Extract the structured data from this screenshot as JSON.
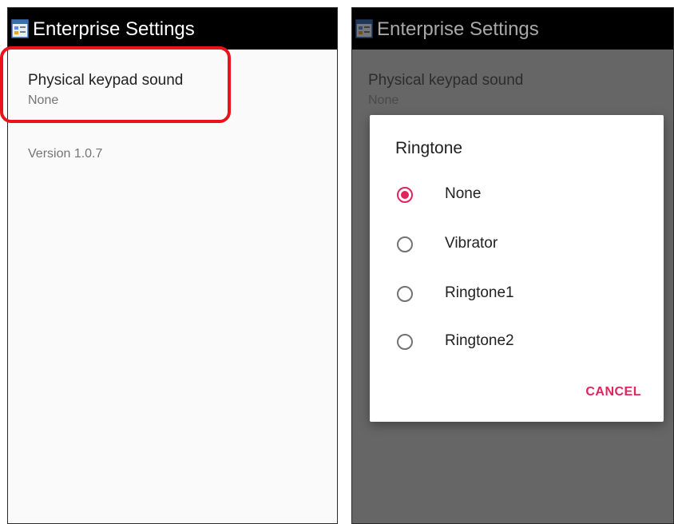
{
  "left_screen": {
    "app_title": "Enterprise Settings",
    "preference": {
      "title": "Physical keypad sound",
      "summary": "None"
    },
    "version": "Version 1.0.7",
    "highlight_color": "#e8131b"
  },
  "right_screen": {
    "app_title": "Enterprise Settings",
    "preference": {
      "title": "Physical keypad sound",
      "summary": "None"
    },
    "dialog": {
      "title": "Ringtone",
      "options": [
        {
          "label": "None",
          "selected": true
        },
        {
          "label": "Vibrator",
          "selected": false
        },
        {
          "label": "Ringtone1",
          "selected": false
        },
        {
          "label": "Ringtone2",
          "selected": false
        }
      ],
      "cancel_label": "CANCEL",
      "accent_color": "#e0245e"
    }
  },
  "icons": {
    "app": "settings-app-icon",
    "radio_selected": "radio-checked-icon",
    "radio_unselected": "radio-unchecked-icon"
  }
}
